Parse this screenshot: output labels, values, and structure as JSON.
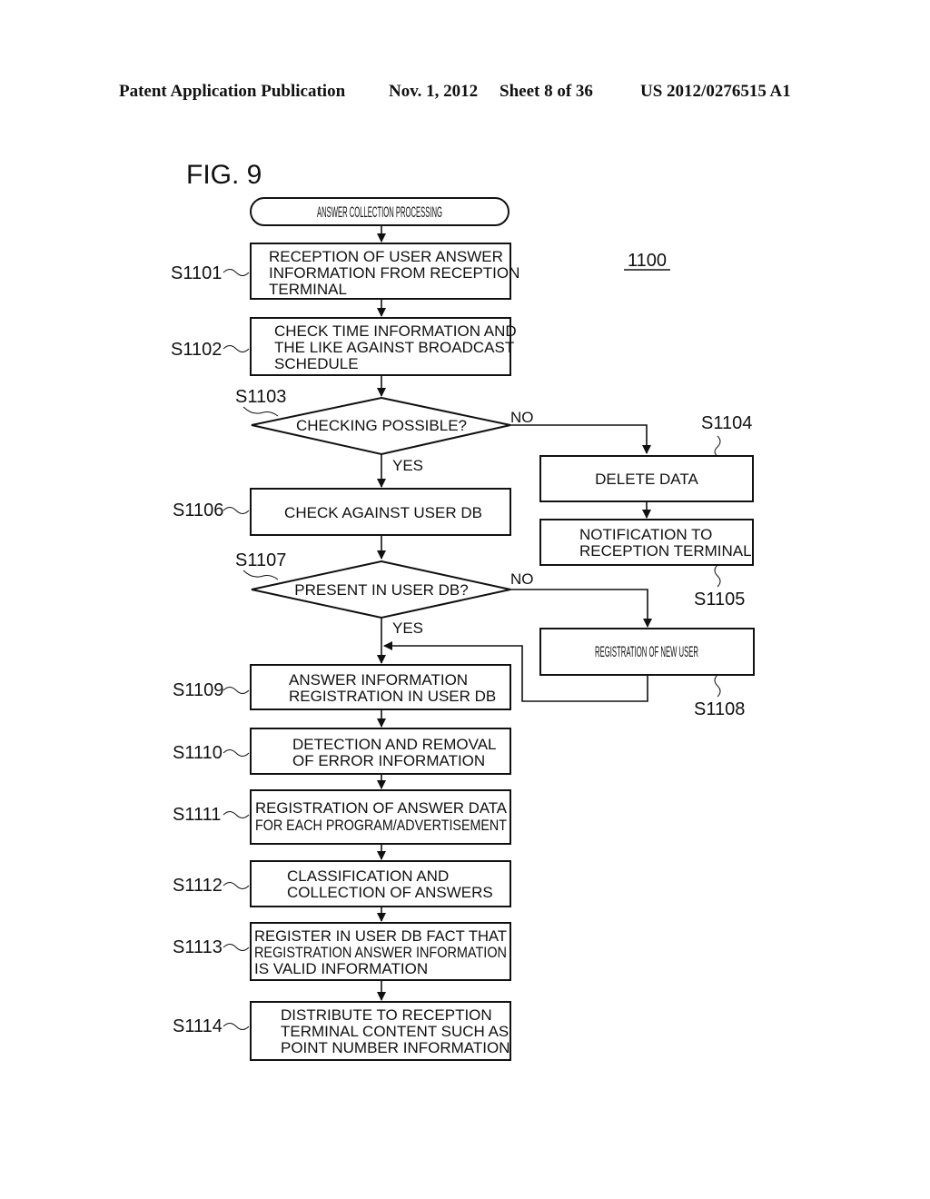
{
  "header": {
    "publication": "Patent Application Publication",
    "date": "Nov. 1, 2012",
    "sheet": "Sheet 8 of 36",
    "number": "US 2012/0276515 A1"
  },
  "figure": {
    "title": "FIG. 9",
    "reference": "1100",
    "start": "ANSWER COLLECTION PROCESSING",
    "steps": {
      "s1101": {
        "label": "S1101",
        "lines": [
          "RECEPTION OF USER ANSWER",
          "INFORMATION FROM RECEPTION",
          "TERMINAL"
        ]
      },
      "s1102": {
        "label": "S1102",
        "lines": [
          "CHECK TIME INFORMATION AND",
          "THE LIKE AGAINST BROADCAST",
          "SCHEDULE"
        ]
      },
      "s1103": {
        "label": "S1103",
        "lines": [
          "CHECKING POSSIBLE?"
        ]
      },
      "s1104": {
        "label": "S1104",
        "lines": [
          "DELETE DATA"
        ]
      },
      "s1105": {
        "label": "S1105",
        "lines": [
          "NOTIFICATION TO",
          "RECEPTION TERMINAL"
        ]
      },
      "s1106": {
        "label": "S1106",
        "lines": [
          "CHECK AGAINST USER DB"
        ]
      },
      "s1107": {
        "label": "S1107",
        "lines": [
          "PRESENT IN USER DB?"
        ]
      },
      "s1108": {
        "label": "S1108",
        "lines": [
          "REGISTRATION OF NEW USER"
        ]
      },
      "s1109": {
        "label": "S1109",
        "lines": [
          "ANSWER INFORMATION",
          "REGISTRATION IN USER DB"
        ]
      },
      "s1110": {
        "label": "S1110",
        "lines": [
          "DETECTION AND REMOVAL",
          "OF ERROR INFORMATION"
        ]
      },
      "s1111": {
        "label": "S1111",
        "lines": [
          "REGISTRATION OF ANSWER DATA",
          "FOR EACH PROGRAM/ADVERTISEMENT"
        ]
      },
      "s1112": {
        "label": "S1112",
        "lines": [
          "CLASSIFICATION AND",
          "COLLECTION OF ANSWERS"
        ]
      },
      "s1113": {
        "label": "S1113",
        "lines": [
          "REGISTER IN USER DB FACT THAT",
          "REGISTRATION ANSWER  INFORMATION",
          "IS VALID INFORMATION"
        ]
      },
      "s1114": {
        "label": "S1114",
        "lines": [
          "DISTRIBUTE TO RECEPTION",
          "TERMINAL CONTENT SUCH AS",
          "POINT NUMBER INFORMATION"
        ]
      }
    },
    "branch_labels": {
      "yes": "YES",
      "no": "NO"
    }
  }
}
